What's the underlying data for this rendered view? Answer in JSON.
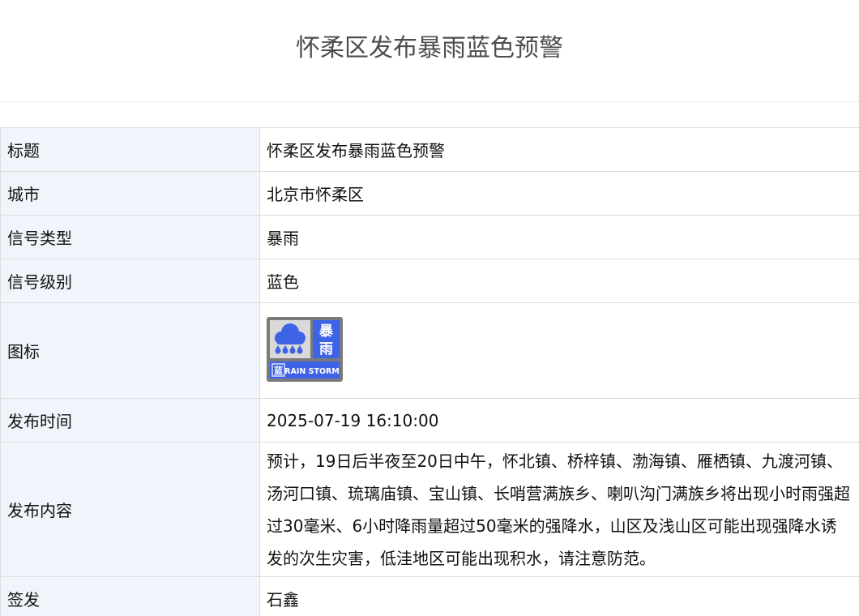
{
  "page": {
    "title": "怀柔区发布暴雨蓝色预警"
  },
  "table": {
    "rows": [
      {
        "label": "标题",
        "value": "怀柔区发布暴雨蓝色预警"
      },
      {
        "label": "城市",
        "value": "北京市怀柔区"
      },
      {
        "label": "信号类型",
        "value": "暴雨"
      },
      {
        "label": "信号级别",
        "value": "蓝色"
      },
      {
        "label": "图标"
      },
      {
        "label": "发布时间",
        "value": "2025-07-19 16:10:00"
      },
      {
        "label": "发布内容",
        "value": "预计，19日后半夜至20日中午，怀北镇、桥梓镇、渤海镇、雁栖镇、九渡河镇、汤河口镇、琉璃庙镇、宝山镇、长哨营满族乡、喇叭沟门满族乡将出现小时雨强超过30毫米、6小时降雨量超过50毫米的强降水，山区及浅山区可能出现强降水诱发的次生灾害，低洼地区可能出现积水，请注意防范。"
      },
      {
        "label": "签发",
        "value": "石鑫"
      }
    ]
  },
  "warning_icon": {
    "icon_name": "rainstorm-blue-warning-icon",
    "char_top": "暴",
    "char_bottom": "雨",
    "level_char": "蓝",
    "caption": "RAIN STORM",
    "colors": {
      "blue": "#3f63e6",
      "gray": "#7a7a7a",
      "white": "#ffffff"
    }
  }
}
